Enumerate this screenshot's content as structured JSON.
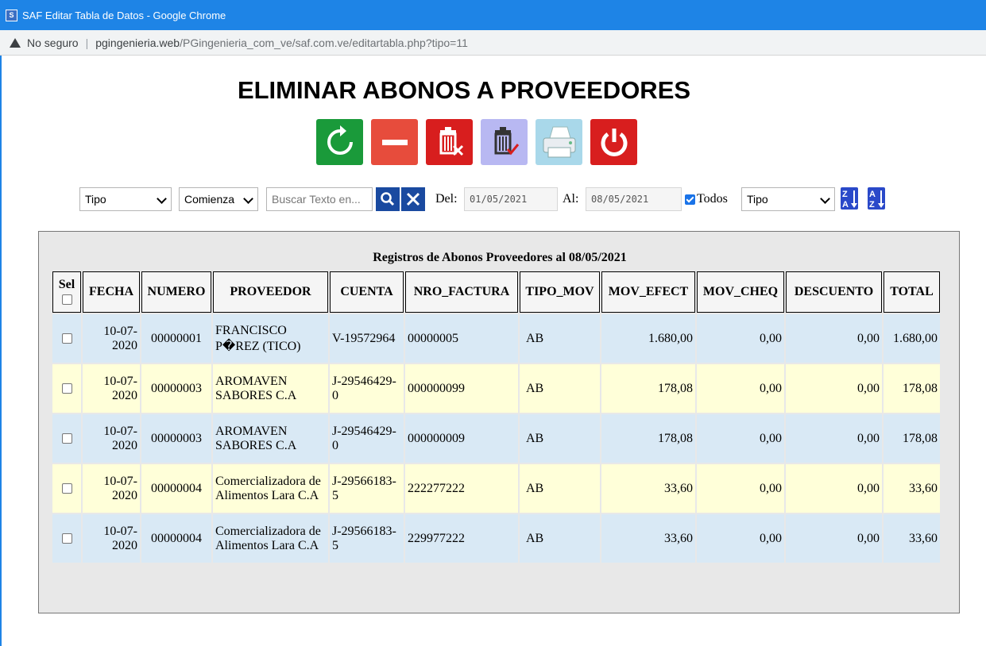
{
  "window": {
    "title": "SAF Editar Tabla de Datos - Google Chrome",
    "icon": "app-icon"
  },
  "address": {
    "security": "No seguro",
    "domain": "pgingenieria.web",
    "path": "/PGingenieria_com_ve/saf.com.ve/editartabla.php?tipo=11"
  },
  "page": {
    "title": "ELIMINAR ABONOS A PROVEEDORES"
  },
  "toolbar": [
    {
      "name": "refresh-icon",
      "color": "#1a9a3a"
    },
    {
      "name": "minus-icon",
      "color": "#e74c3c"
    },
    {
      "name": "delete-x-icon",
      "color": "#d81e1e"
    },
    {
      "name": "delete-check-icon",
      "color": "#b8b8f2"
    },
    {
      "name": "printer-icon",
      "color": "#a9d8ea"
    },
    {
      "name": "power-icon",
      "color": "#d81e1e"
    }
  ],
  "filters": {
    "field_select": "Tipo",
    "match_select": "Comienza",
    "search_placeholder": "Buscar Texto en...",
    "from_label": "Del:",
    "from_date": "01/05/2021",
    "to_label": "Al:",
    "to_date": "08/05/2021",
    "all_label": "Todos",
    "sort_select": "Tipo"
  },
  "table": {
    "caption": "Registros de Abonos Proveedores al 08/05/2021",
    "sel_header": "Sel",
    "columns": [
      "FECHA",
      "NUMERO",
      "PROVEEDOR",
      "CUENTA",
      "NRO_FACTURA",
      "TIPO_MOV",
      "MOV_EFECT",
      "MOV_CHEQ",
      "DESCUENTO",
      "TOTAL"
    ],
    "rows": [
      {
        "fecha": "10-07-2020",
        "numero": "00000001",
        "proveedor": "FRANCISCO P�REZ (TICO)",
        "cuenta": "V-19572964",
        "nro_factura": "00000005",
        "tipo_mov": "AB",
        "mov_efect": "1.680,00",
        "mov_cheq": "0,00",
        "descuento": "0,00",
        "total": "1.680,00"
      },
      {
        "fecha": "10-07-2020",
        "numero": "00000003",
        "proveedor": "AROMAVEN SABORES C.A",
        "cuenta": "J-29546429-0",
        "nro_factura": "000000099",
        "tipo_mov": "AB",
        "mov_efect": "178,08",
        "mov_cheq": "0,00",
        "descuento": "0,00",
        "total": "178,08"
      },
      {
        "fecha": "10-07-2020",
        "numero": "00000003",
        "proveedor": "AROMAVEN SABORES C.A",
        "cuenta": "J-29546429-0",
        "nro_factura": "000000009",
        "tipo_mov": "AB",
        "mov_efect": "178,08",
        "mov_cheq": "0,00",
        "descuento": "0,00",
        "total": "178,08"
      },
      {
        "fecha": "10-07-2020",
        "numero": "00000004",
        "proveedor": "Comercializadora de Alimentos Lara C.A",
        "cuenta": "J-29566183-5",
        "nro_factura": "222277222",
        "tipo_mov": "AB",
        "mov_efect": "33,60",
        "mov_cheq": "0,00",
        "descuento": "0,00",
        "total": "33,60"
      },
      {
        "fecha": "10-07-2020",
        "numero": "00000004",
        "proveedor": "Comercializadora de Alimentos Lara C.A",
        "cuenta": "J-29566183-5",
        "nro_factura": "229977222",
        "tipo_mov": "AB",
        "mov_efect": "33,60",
        "mov_cheq": "0,00",
        "descuento": "0,00",
        "total": "33,60"
      }
    ]
  }
}
